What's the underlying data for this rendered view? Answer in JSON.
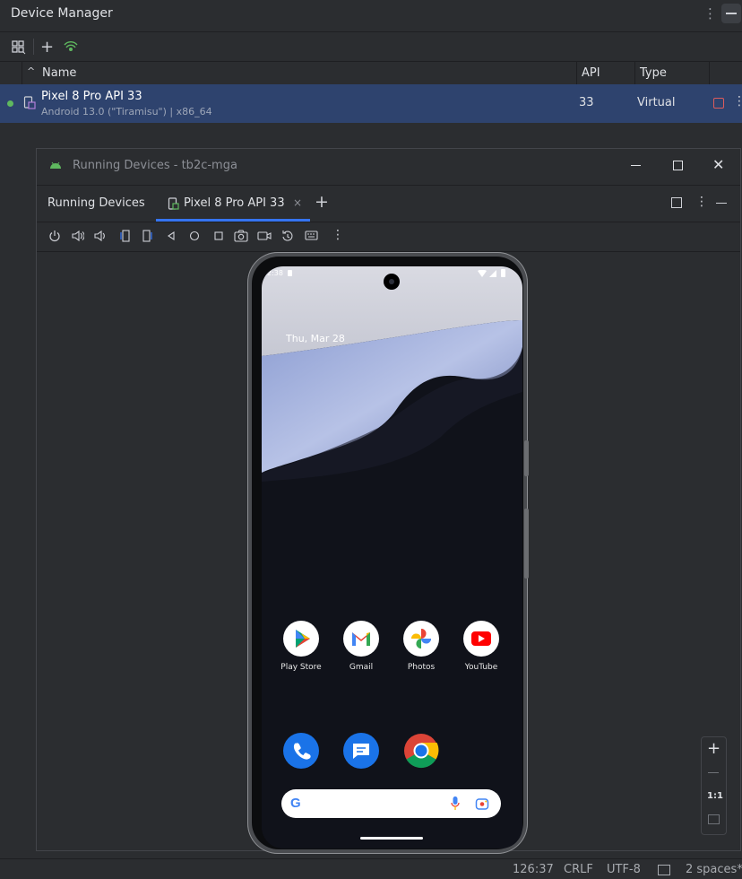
{
  "device_manager": {
    "title": "Device Manager",
    "columns": {
      "name": "Name",
      "api": "API",
      "type": "Type"
    },
    "devices": [
      {
        "name": "Pixel 8 Pro API 33",
        "details": "Android 13.0 (\"Tiramisu\") | x86_64",
        "api": "33",
        "type": "Virtual",
        "status_color": "#5fb85f"
      }
    ]
  },
  "running_devices": {
    "window_title": "Running Devices - tb2c-mga",
    "panel_title": "Running Devices",
    "tab_label": "Pixel 8 Pro API 33",
    "accent_color": "#3574f0"
  },
  "phone": {
    "time": "2:38",
    "date": "Thu, Mar 28",
    "apps_row1": [
      {
        "label": "Play Store",
        "icon": "play-store-icon"
      },
      {
        "label": "Gmail",
        "icon": "gmail-icon"
      },
      {
        "label": "Photos",
        "icon": "photos-icon"
      },
      {
        "label": "YouTube",
        "icon": "youtube-icon"
      }
    ],
    "dock": [
      {
        "icon": "phone-app-icon"
      },
      {
        "icon": "messages-app-icon"
      },
      {
        "icon": "chrome-app-icon"
      }
    ]
  },
  "zoom": {
    "one_to_one": "1:1"
  },
  "status_bar": {
    "position": "126:37",
    "line_ending": "CRLF",
    "encoding": "UTF-8",
    "indent": "2 spaces*"
  }
}
